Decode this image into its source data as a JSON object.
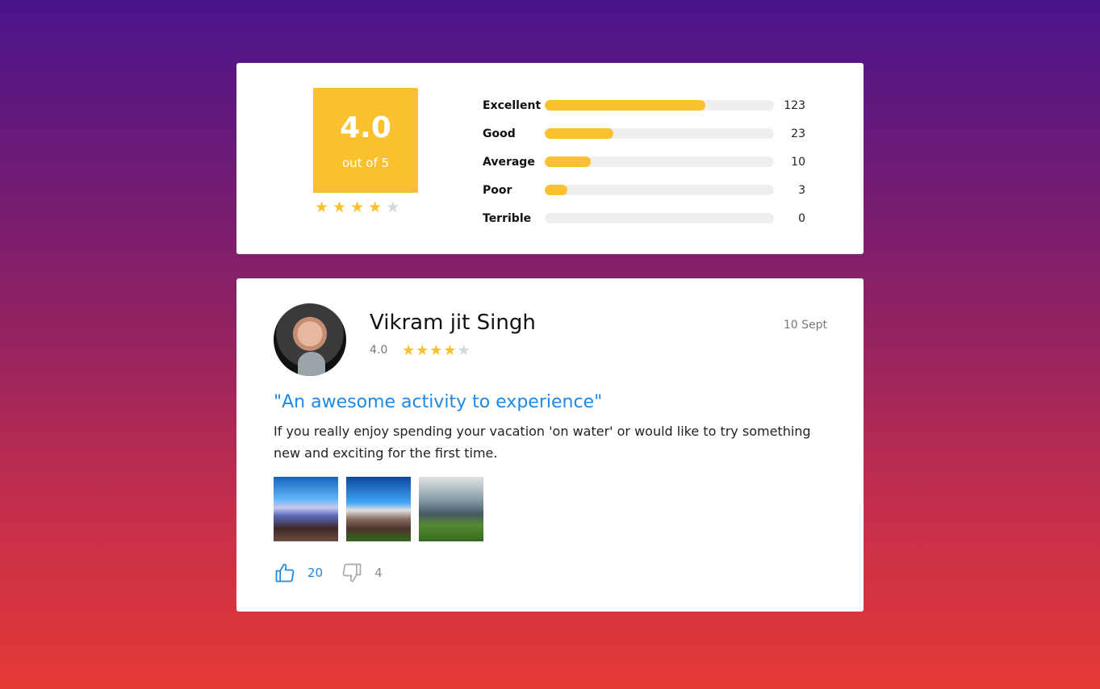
{
  "summary": {
    "score": "4.0",
    "score_sub": "out of 5",
    "stars_filled": 4,
    "stars_total": 5,
    "distribution": [
      {
        "label": "Excellent",
        "count": "123",
        "fill": 0.7
      },
      {
        "label": "Good",
        "count": "23",
        "fill": 0.3
      },
      {
        "label": "Average",
        "count": "10",
        "fill": 0.2
      },
      {
        "label": "Poor",
        "count": "3",
        "fill": 0.1
      },
      {
        "label": "Terrible",
        "count": "0",
        "fill": 0
      }
    ]
  },
  "review": {
    "name": "Vikram jit Singh",
    "rating": "4.0",
    "stars_filled": 4,
    "stars_total": 5,
    "date": "10 Sept",
    "title": "\"An awesome activity to experience\"",
    "body": "If you really enjoy spending your vacation 'on water' or would like to try something new and exciting for the first time.",
    "photos_count": 3,
    "likes": "20",
    "dislikes": "4"
  },
  "colors": {
    "accent": "#fbc02d",
    "link": "#1e88e5",
    "star_off": "#cfd8dc"
  },
  "icons": {
    "star": "star-icon",
    "like": "thumbs-up-icon",
    "dislike": "thumbs-down-icon"
  }
}
